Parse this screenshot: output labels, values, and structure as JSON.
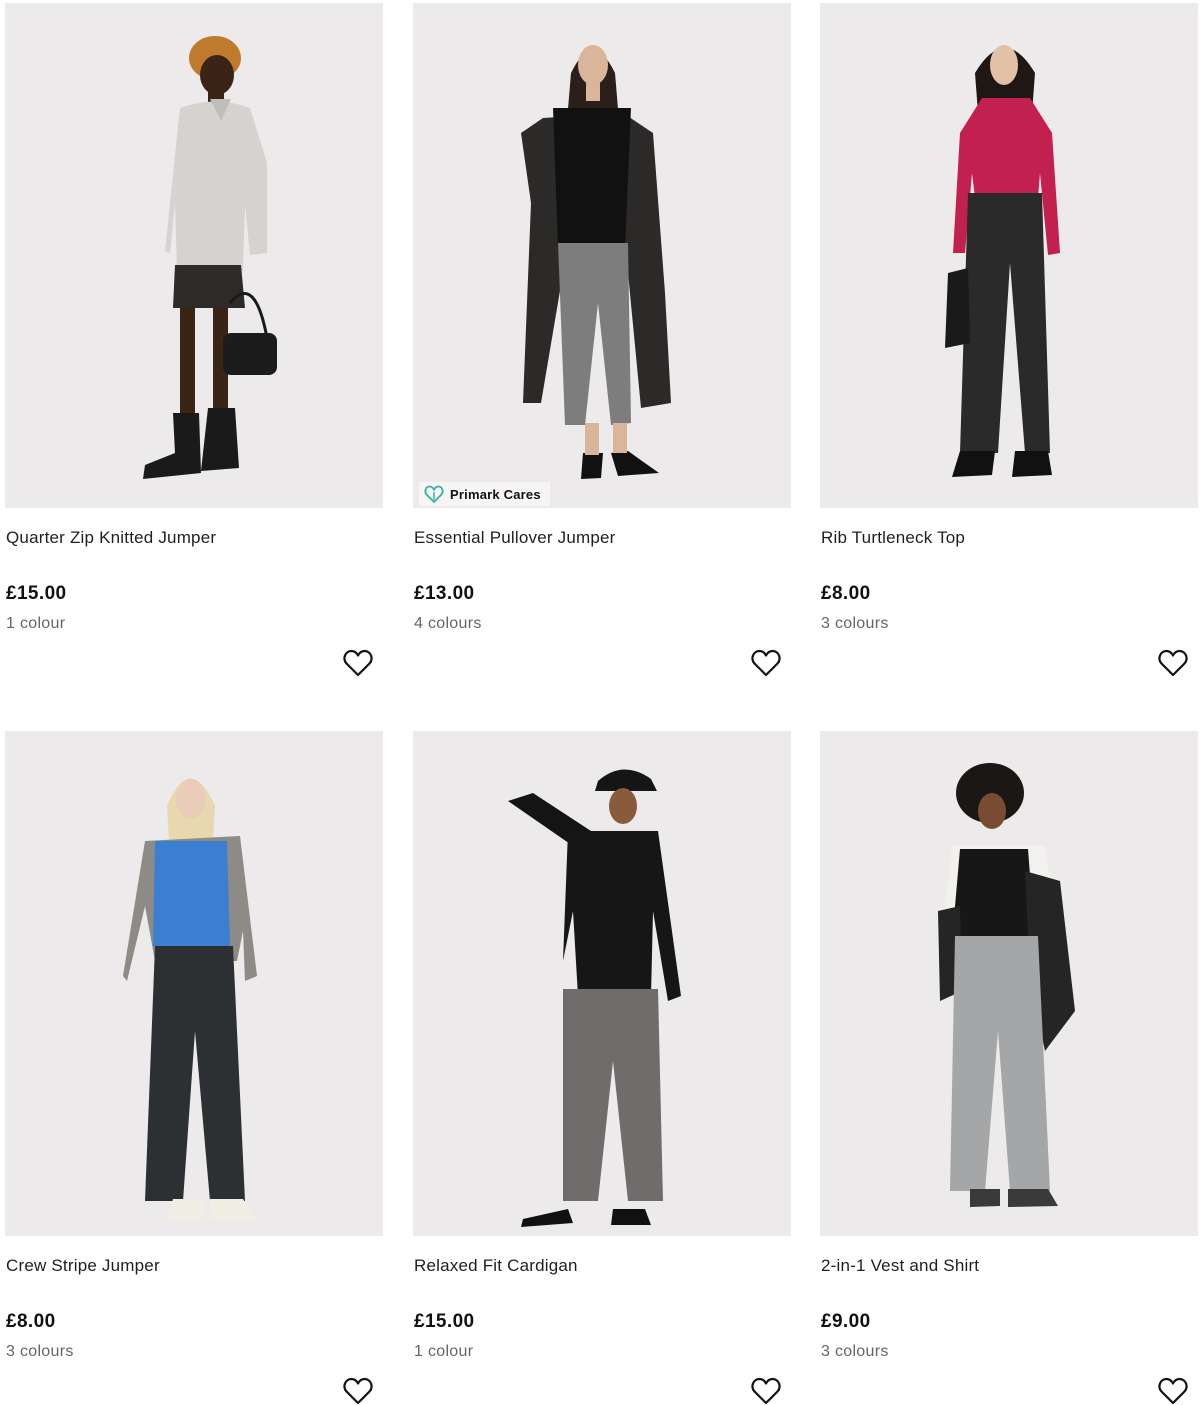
{
  "products": [
    {
      "name": "Quarter Zip Knitted Jumper",
      "price": "£15.00",
      "colours": "1 colour",
      "badge": null,
      "wishlist_icon": "heart-outline-icon"
    },
    {
      "name": "Essential Pullover Jumper",
      "price": "£13.00",
      "colours": "4 colours",
      "badge": {
        "label": "Primark Cares",
        "icon": "heart-leaf-icon",
        "color": "#2fb3a8"
      },
      "wishlist_icon": "heart-outline-icon"
    },
    {
      "name": "Rib Turtleneck Top",
      "price": "£8.00",
      "colours": "3 colours",
      "badge": null,
      "wishlist_icon": "heart-outline-icon"
    },
    {
      "name": "Crew Stripe Jumper",
      "price": "£8.00",
      "colours": "3 colours",
      "badge": null,
      "wishlist_icon": "heart-outline-icon"
    },
    {
      "name": "Relaxed Fit Cardigan",
      "price": "£15.00",
      "colours": "1 colour",
      "badge": null,
      "wishlist_icon": "heart-outline-icon"
    },
    {
      "name": "2-in-1 Vest and Shirt",
      "price": "£9.00",
      "colours": "3 colours",
      "badge": null,
      "wishlist_icon": "heart-outline-icon"
    }
  ],
  "colors": {
    "image_background": "#eceaea",
    "text": "#1f1f1f",
    "muted_text": "#666666",
    "badge_accent": "#2fb3a8"
  }
}
